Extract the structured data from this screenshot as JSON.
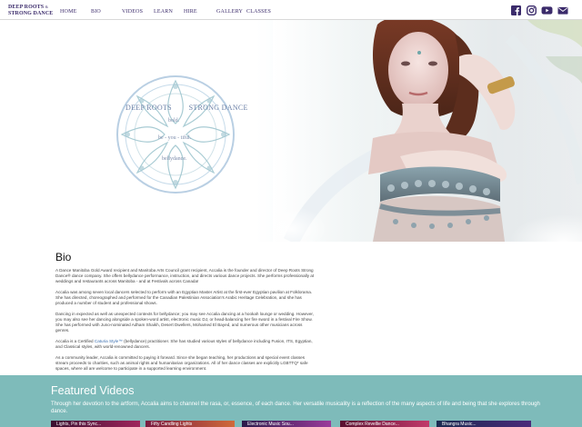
{
  "brand": {
    "line1": "DEEP ROOTS",
    "amp": "&",
    "line2": "STRONG DANCE"
  },
  "nav": {
    "items": [
      {
        "label": "HOME"
      },
      {
        "label": "BIO"
      },
      {
        "label": "VIDEOS"
      },
      {
        "label": "LEARN"
      },
      {
        "label": "HIRE"
      },
      {
        "label": "GALLERY"
      },
      {
        "label": "CLASSES"
      }
    ],
    "social": [
      "facebook-icon",
      "instagram-icon",
      "youtube-icon",
      "email-icon"
    ]
  },
  "hero": {
    "seal_title_left": "DEEP ROOTS",
    "seal_title_right": "STRONG DANCE",
    "seal_word1": "bold.",
    "seal_word2": "be - you - tiful.",
    "seal_word3": "bellydance."
  },
  "bio": {
    "heading": "Bio",
    "p1": "A Dance Manitoba Gold Award recipient and Manitoba Arts Council grant recipient, Accalia is the founder and director of Deep Roots Strong Dance® dance company. She offers bellydance performance, instruction, and directs various dance projects. She performs professionally at weddings and restaurants across Manitoba - and at Festivals across Canada!",
    "p2": "Accalia was among seven local dancers selected to perform with an Egyptian Master Artist at the first-ever Egyptian pavilion at Folklorama. She has directed, choreographed and performed for the Canadian Palestinian Association's Arabic Heritage Celebration, and she has produced a number of student and professional shows.",
    "p3": "Dancing in expected as well as unexpected contexts for bellydance; you may see Accalia dancing at a hookah lounge or wedding. However, you may also see her dancing alongside a spoken-word artist, electronic music DJ, or head-balancing her fire sword in a festival Fire Show. She has performed with Juno-nominated Adham Shaikh, Desert Dwellers, Mohamed El Bayed, and numerous other musicians across genres.",
    "p4_pre": "Accalia is a Certified ",
    "p4_link": "Caturia Style™",
    "p4_post": " (bellydance) practitioner. She has studied various styles of bellydance including Fusion, ITS, Egyptian, and Classical styles, with world-renowned dancers.",
    "p5": "As a community leader, Accalia is committed to paying it forward. Since she began teaching, her productions and special event classes stream proceeds to charities, such as animal rights and humanitarian organizations. All of her dance classes are explicitly LGBTTQ* safe spaces, where all are welcome to participate in a supported learning environment."
  },
  "featured": {
    "heading": "Featured Videos",
    "description": "Through her devotion to the artform, Accalia aims to channel the rasa, or, essence, of each dance. Her versatile musicality is a reflection of the many aspects of life and being that she explores through dance.",
    "videos": [
      {
        "title": "Lights, Pin this Sync..."
      },
      {
        "title": "Fifty Candling Lights"
      },
      {
        "title": "Electronic Music Sou..."
      },
      {
        "title": "Complex Revellie Dance..."
      },
      {
        "title": "Bhangra Music..."
      }
    ]
  },
  "colors": {
    "brand": "#3b2b6b",
    "teal": "#7ebbba",
    "link": "#3a6fb0"
  }
}
